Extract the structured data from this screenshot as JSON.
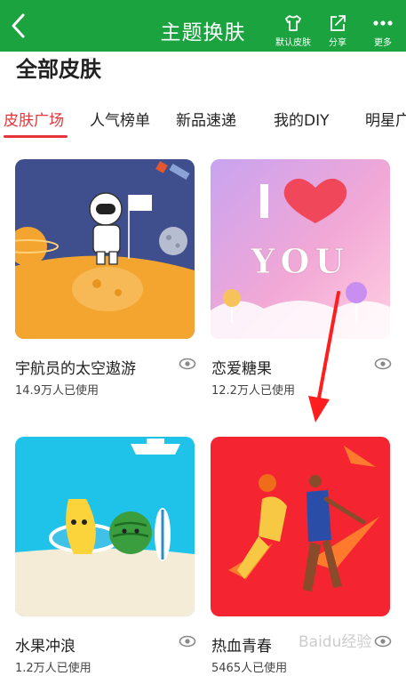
{
  "header": {
    "title": "主题换肤",
    "actions": [
      {
        "label": "默认皮肤",
        "icon": "tshirt-icon"
      },
      {
        "label": "分享",
        "icon": "share-icon"
      },
      {
        "label": "更多",
        "icon": "more-icon"
      }
    ]
  },
  "page": {
    "heading": "全部皮肤"
  },
  "tabs": [
    {
      "label": "皮肤广场",
      "active": true
    },
    {
      "label": "人气榜单",
      "active": false
    },
    {
      "label": "新品速递",
      "active": false
    },
    {
      "label": "我的DIY",
      "active": false
    },
    {
      "label": "明星广",
      "active": false
    }
  ],
  "skins": [
    {
      "name": "宇航员的太空遨游",
      "count": "14.9万人已使用",
      "icon": "astronaut-icon"
    },
    {
      "name": "恋爱糖果",
      "count": "12.2万人已使用",
      "icon": "heart-icon"
    },
    {
      "name": "水果冲浪",
      "count": "1.2万人已使用",
      "icon": "fruit-icon"
    },
    {
      "name": "热血青春",
      "count": "5465人已使用",
      "icon": "basketball-icon"
    }
  ],
  "watermark": "Baidu经验",
  "colors": {
    "header": "#1aa33f",
    "active_tab": "#e6353a",
    "annotation_arrow": "#ff1e1e"
  }
}
